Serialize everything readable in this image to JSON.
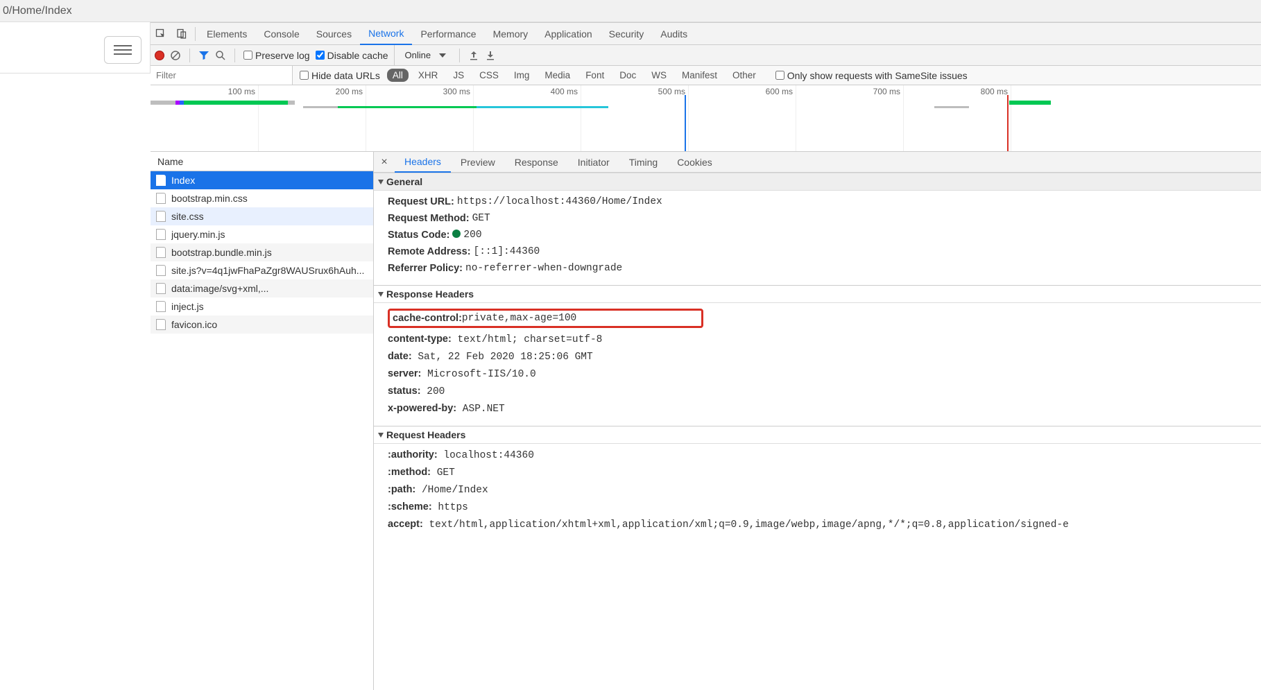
{
  "address_bar": {
    "text": "0/Home/Index"
  },
  "main_tabs": {
    "items": [
      {
        "label": "Elements"
      },
      {
        "label": "Console"
      },
      {
        "label": "Sources"
      },
      {
        "label": "Network"
      },
      {
        "label": "Performance"
      },
      {
        "label": "Memory"
      },
      {
        "label": "Application"
      },
      {
        "label": "Security"
      },
      {
        "label": "Audits"
      }
    ],
    "active_index": 3
  },
  "toolbar": {
    "preserve_log_label": "Preserve log",
    "disable_cache_label": "Disable cache",
    "disable_cache_checked": true,
    "preserve_log_checked": false,
    "throttle_value": "Online"
  },
  "filter_row": {
    "filter_placeholder": "Filter",
    "hide_data_urls_label": "Hide data URLs",
    "types": [
      "All",
      "XHR",
      "JS",
      "CSS",
      "Img",
      "Media",
      "Font",
      "Doc",
      "WS",
      "Manifest",
      "Other"
    ],
    "active_type_index": 0,
    "samesite_label": "Only show requests with SameSite issues"
  },
  "timeline": {
    "ticks": [
      "100 ms",
      "200 ms",
      "300 ms",
      "400 ms",
      "500 ms",
      "600 ms",
      "700 ms",
      "800 ms"
    ]
  },
  "requests": {
    "header": "Name",
    "items": [
      {
        "name": "Index",
        "selected": true
      },
      {
        "name": "bootstrap.min.css"
      },
      {
        "name": "site.css",
        "hover": true
      },
      {
        "name": "jquery.min.js"
      },
      {
        "name": "bootstrap.bundle.min.js"
      },
      {
        "name": "site.js?v=4q1jwFhaPaZgr8WAUSrux6hAuh..."
      },
      {
        "name": "data:image/svg+xml,..."
      },
      {
        "name": "inject.js"
      },
      {
        "name": "favicon.ico"
      }
    ]
  },
  "details_tabs": {
    "items": [
      "Headers",
      "Preview",
      "Response",
      "Initiator",
      "Timing",
      "Cookies"
    ],
    "active_index": 0
  },
  "general": {
    "title": "General",
    "request_url_key": "Request URL:",
    "request_url_val": "https://localhost:44360/Home/Index",
    "request_method_key": "Request Method:",
    "request_method_val": "GET",
    "status_code_key": "Status Code:",
    "status_code_val": "200",
    "remote_address_key": "Remote Address:",
    "remote_address_val": "[::1]:44360",
    "referrer_policy_key": "Referrer Policy:",
    "referrer_policy_val": "no-referrer-when-downgrade"
  },
  "response_headers": {
    "title": "Response Headers",
    "rows": [
      {
        "k": "cache-control:",
        "v": "private,max-age=100",
        "highlight": true
      },
      {
        "k": "content-type:",
        "v": "text/html; charset=utf-8"
      },
      {
        "k": "date:",
        "v": "Sat, 22 Feb 2020 18:25:06 GMT"
      },
      {
        "k": "server:",
        "v": "Microsoft-IIS/10.0"
      },
      {
        "k": "status:",
        "v": "200"
      },
      {
        "k": "x-powered-by:",
        "v": "ASP.NET"
      }
    ]
  },
  "request_headers": {
    "title": "Request Headers",
    "rows": [
      {
        "k": ":authority:",
        "v": "localhost:44360"
      },
      {
        "k": ":method:",
        "v": "GET"
      },
      {
        "k": ":path:",
        "v": "/Home/Index"
      },
      {
        "k": ":scheme:",
        "v": "https"
      },
      {
        "k": "accept:",
        "v": "text/html,application/xhtml+xml,application/xml;q=0.9,image/webp,image/apng,*/*;q=0.8,application/signed-e"
      }
    ]
  }
}
